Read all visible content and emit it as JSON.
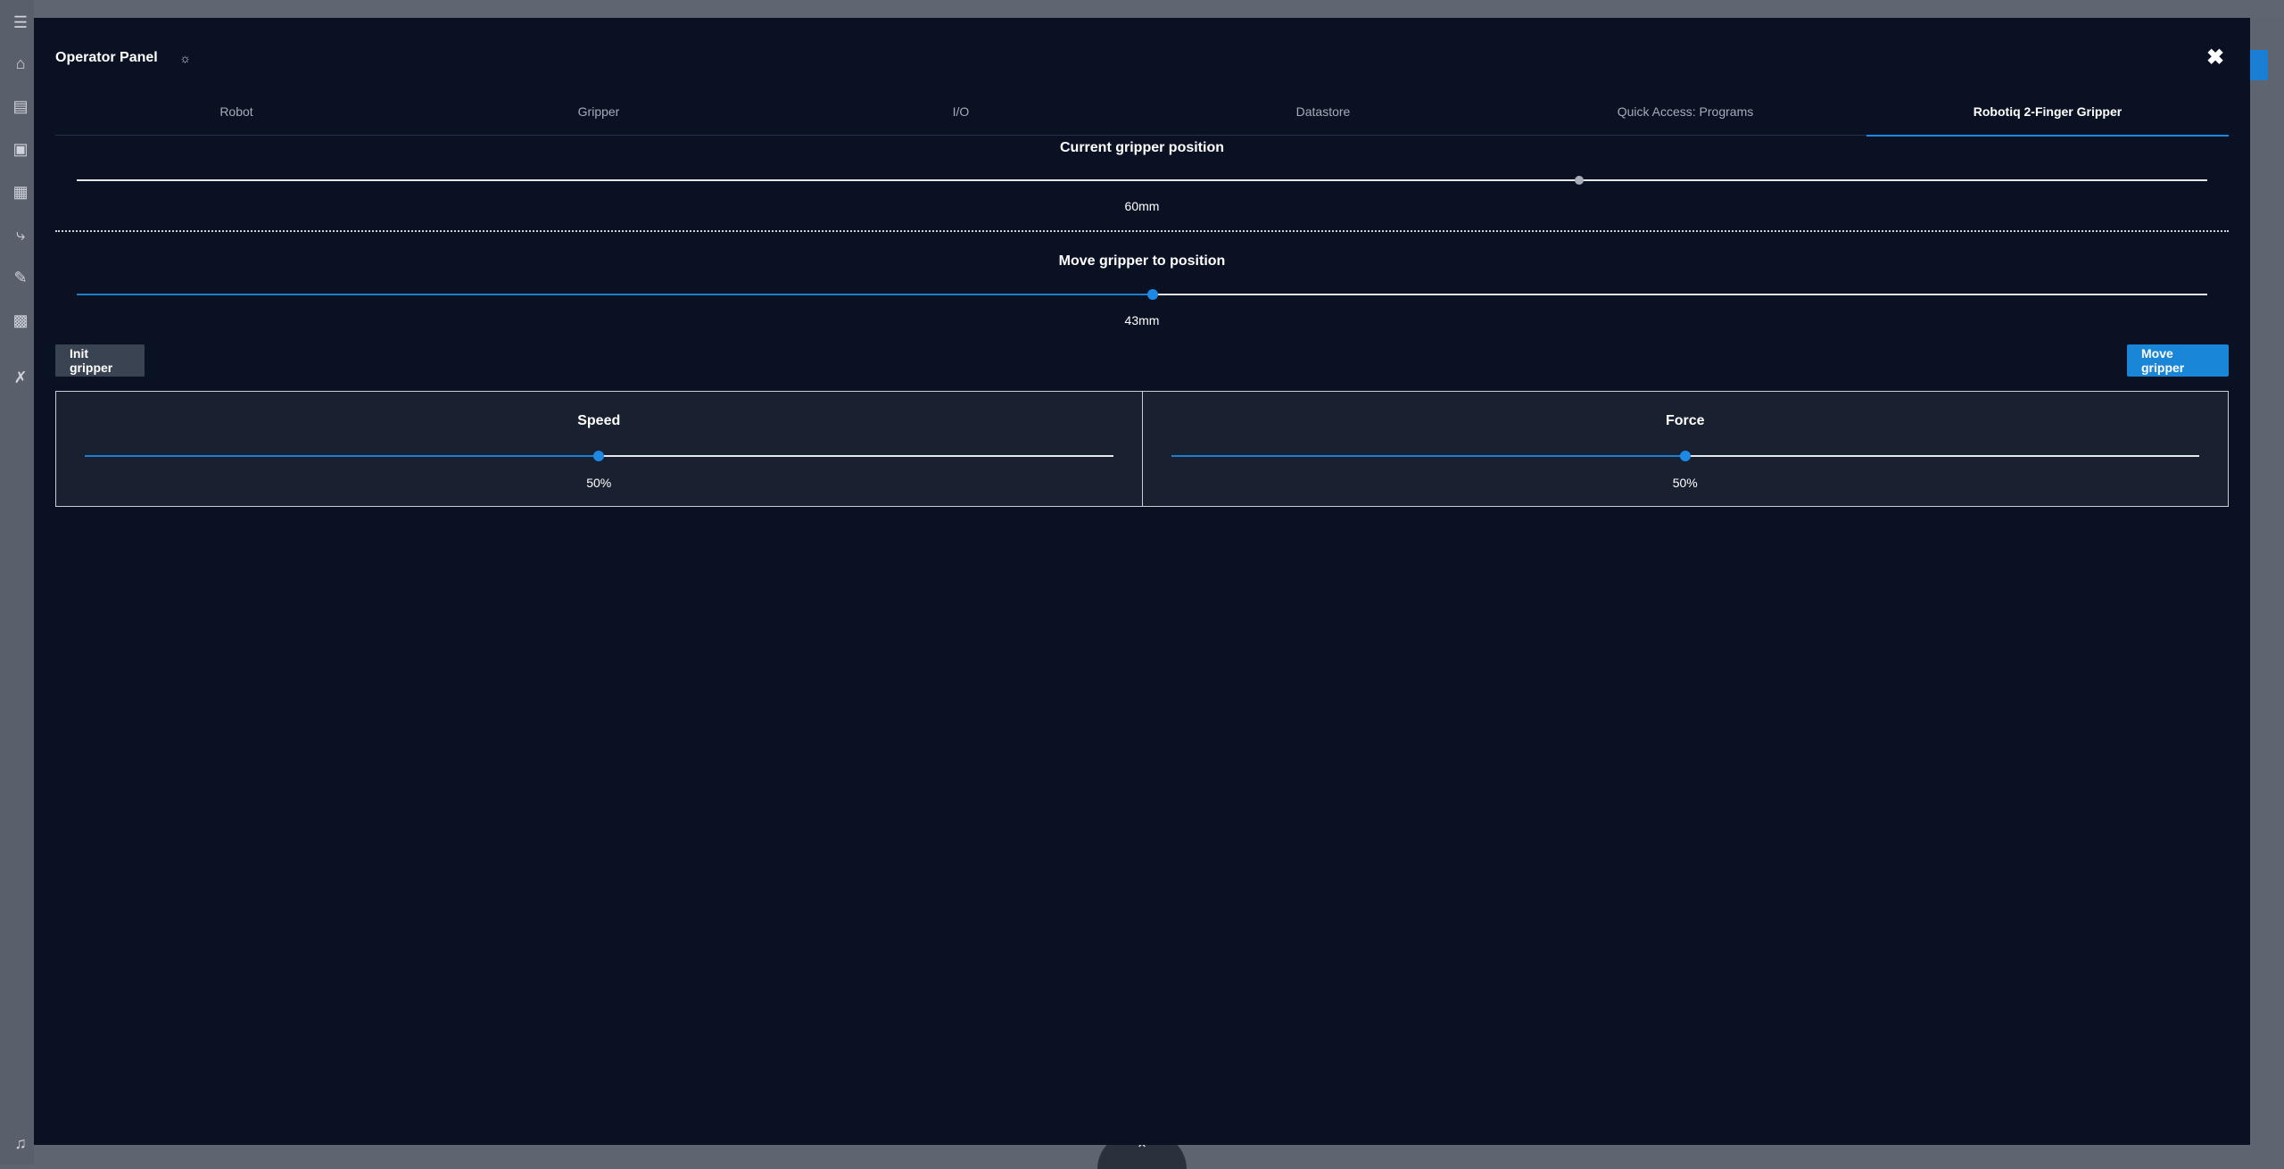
{
  "modal": {
    "title": "Operator Panel",
    "close_icon": "close-icon",
    "bulb_icon": "lightbulb-icon"
  },
  "tabs": [
    {
      "label": "Robot",
      "active": false
    },
    {
      "label": "Gripper",
      "active": false
    },
    {
      "label": "I/O",
      "active": false
    },
    {
      "label": "Datastore",
      "active": false
    },
    {
      "label": "Quick Access: Programs",
      "active": false
    },
    {
      "label": "Robotiq 2-Finger Gripper",
      "active": true
    }
  ],
  "current_position": {
    "title": "Current gripper position",
    "value_label": "60mm",
    "fraction": 0.705
  },
  "target_position": {
    "title": "Move gripper to position",
    "value_label": "43mm",
    "fraction": 0.505
  },
  "buttons": {
    "init_label": "Init gripper",
    "move_label": "Move gripper"
  },
  "speed": {
    "title": "Speed",
    "value_label": "50%",
    "fraction": 0.5
  },
  "force": {
    "title": "Force",
    "value_label": "50%",
    "fraction": 0.5
  },
  "colors": {
    "accent": "#1e88e5",
    "modal_bg": "#0a1122",
    "panel_bg": "#19202f"
  }
}
